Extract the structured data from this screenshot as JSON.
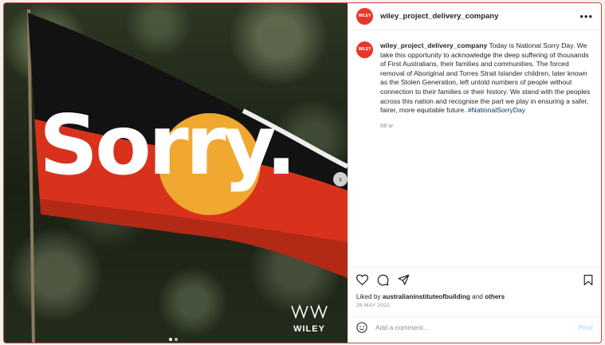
{
  "image": {
    "headline": "Sorry.",
    "brand": "WILEY"
  },
  "post": {
    "username": "wiley_project_delivery_company",
    "avatar_text": "WILEY",
    "more_icon": "ellipsis-icon",
    "caption_text": "Today is National Sorry Day. We take this opportunity to acknowledge the deep suffering of thousands of First Australians, their families and communities. The forced removal of Aboriginal and Torres Strait Islander children, later known as the Stolen Generation, left untold numbers of people without connection to their families or their history. We stand with the peoples across this nation and recognise the part we play in ensuring a safer, fairer, more equitable future.",
    "hashtag": "#NationalSorryDay",
    "time_ago": "68 w",
    "liked_by_prefix": "Liked by",
    "liked_by_user": "australianinstituteofbuilding",
    "liked_and": "and",
    "liked_others": "others",
    "date": "26 MAY 2022",
    "comment_placeholder": "Add a comment...",
    "post_label": "Post"
  },
  "colors": {
    "flag_black": "#121212",
    "flag_red": "#d9321c",
    "flag_sun": "#f0a830",
    "accent_link": "#00376b",
    "brand_red": "#e4382b"
  }
}
